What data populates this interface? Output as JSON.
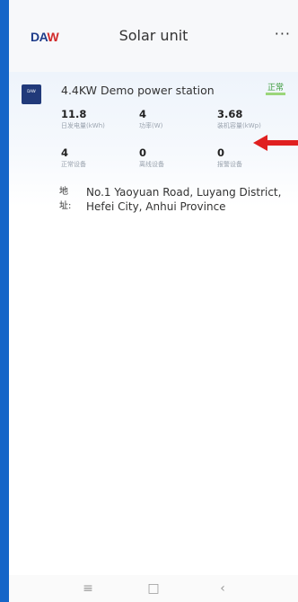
{
  "header": {
    "logo_left": "DA",
    "logo_right": "W",
    "title": "Solar unit",
    "more_label": "···"
  },
  "station": {
    "name": "4.4KW Demo power station",
    "status": "正常",
    "thumbnail_label": "DAW",
    "metrics": [
      {
        "value": "11.8",
        "label": "日发电量(kWh)"
      },
      {
        "value": "4",
        "label": "功率(W)"
      },
      {
        "value": "3.68",
        "label": "装机容量(kWp)"
      },
      {
        "value": "4",
        "label": "正常设备"
      },
      {
        "value": "0",
        "label": "离线设备"
      },
      {
        "value": "0",
        "label": "报警设备"
      }
    ],
    "address_label": "地址:",
    "address": "No.1 Yaoyuan Road, Luyang District, Hefei City, Anhui Province"
  },
  "colors": {
    "frame_blue": "#1565c8",
    "arrow_red": "#e02020",
    "status_green": "#3a9a3a"
  },
  "navbar": {
    "menu_glyph": "≡",
    "home_glyph": "□",
    "back_glyph": "‹"
  }
}
